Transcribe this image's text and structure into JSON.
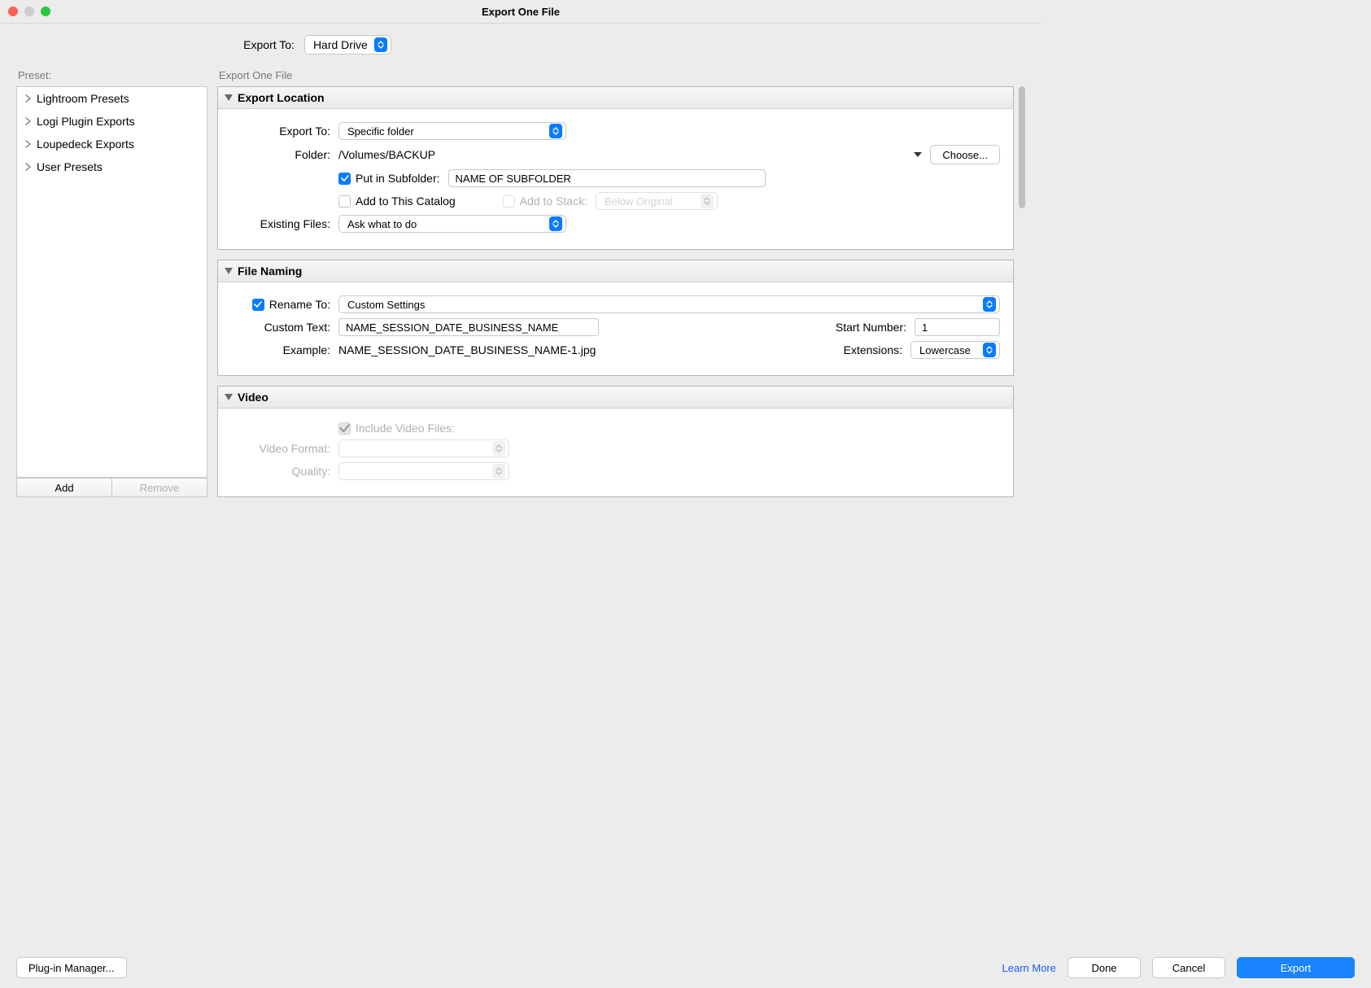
{
  "window": {
    "title": "Export One File"
  },
  "top": {
    "export_to_label": "Export To:",
    "export_to_value": "Hard Drive"
  },
  "sidebar": {
    "header": "Preset:",
    "items": [
      {
        "label": "Lightroom Presets"
      },
      {
        "label": "Logi Plugin Exports"
      },
      {
        "label": "Loupedeck Exports"
      },
      {
        "label": "User Presets"
      }
    ],
    "add_label": "Add",
    "remove_label": "Remove"
  },
  "right_header": "Export One File",
  "panels": {
    "export_location": {
      "title": "Export Location",
      "export_to_label": "Export To:",
      "export_to_value": "Specific folder",
      "folder_label": "Folder:",
      "folder_value": "/Volumes/BACKUP",
      "choose_label": "Choose...",
      "put_subfolder_label": "Put in Subfolder:",
      "subfolder_value": "NAME OF SUBFOLDER",
      "add_catalog_label": "Add to This Catalog",
      "add_stack_label": "Add to Stack:",
      "stack_value": "Below Original",
      "existing_label": "Existing Files:",
      "existing_value": "Ask what to do"
    },
    "file_naming": {
      "title": "File Naming",
      "rename_label": "Rename To:",
      "rename_value": "Custom Settings",
      "custom_text_label": "Custom Text:",
      "custom_text_value": "NAME_SESSION_DATE_BUSINESS_NAME",
      "start_number_label": "Start Number:",
      "start_number_value": "1",
      "example_label": "Example:",
      "example_value": "NAME_SESSION_DATE_BUSINESS_NAME-1.jpg",
      "extensions_label": "Extensions:",
      "extensions_value": "Lowercase"
    },
    "video": {
      "title": "Video",
      "include_label": "Include Video Files:",
      "format_label": "Video Format:",
      "quality_label": "Quality:"
    }
  },
  "footer": {
    "plugin_manager": "Plug-in Manager...",
    "learn_more": "Learn More",
    "done": "Done",
    "cancel": "Cancel",
    "export": "Export"
  }
}
